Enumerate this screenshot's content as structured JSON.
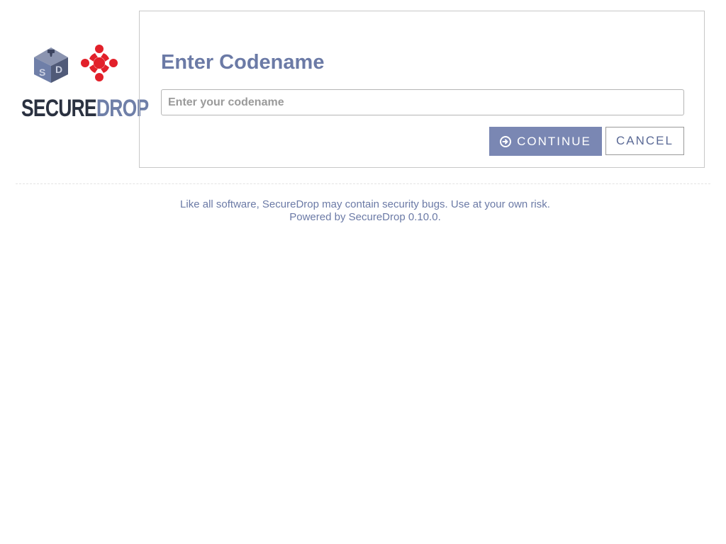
{
  "logo": {
    "wordmark_secure": "SECURE",
    "wordmark_drop": "DROP",
    "cube_letters": [
      "S",
      "D"
    ],
    "colors": {
      "cube_top": "#8b94b0",
      "cube_left": "#6f7fa8",
      "cube_right": "#505a78",
      "partner_logo": "#e2202a"
    }
  },
  "login": {
    "heading": "Enter Codename",
    "input_placeholder": "Enter your codename",
    "input_value": "",
    "continue_label": "CONTINUE",
    "continue_icon": "circle-arrow-right-icon",
    "cancel_label": "CANCEL"
  },
  "footer": {
    "warning": "Like all software, SecureDrop may contain security bugs. Use at your own risk.",
    "powered_prefix": "Powered by ",
    "powered_link": "SecureDrop 0.10.0",
    "powered_suffix": "."
  },
  "colors": {
    "accent": "#6b7aa6",
    "button_bg": "#7a87b3"
  }
}
